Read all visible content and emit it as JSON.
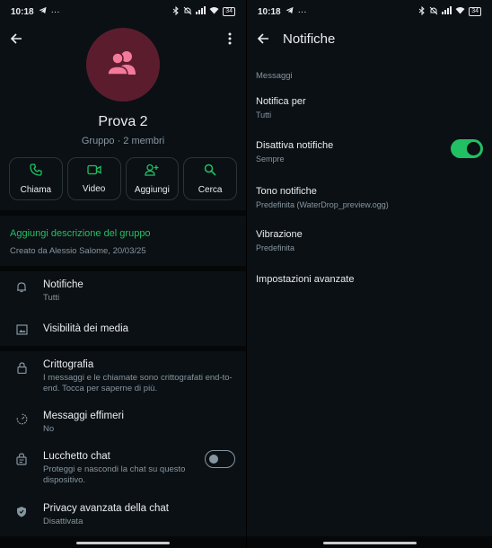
{
  "status_left": {
    "time": "10:18",
    "dots": "···",
    "battery": "34"
  },
  "status_right": {
    "time": "10:18",
    "dots": "···",
    "battery": "34"
  },
  "group_info": {
    "name": "Prova 2",
    "subtitle": "Gruppo · 2 membri",
    "actions": [
      {
        "label": "Chiama",
        "icon": "phone-icon"
      },
      {
        "label": "Video",
        "icon": "video-icon"
      },
      {
        "label": "Aggiungi",
        "icon": "add-person-icon"
      },
      {
        "label": "Cerca",
        "icon": "search-icon"
      }
    ],
    "add_description": "Aggiungi descrizione del gruppo",
    "created_by": "Creato da Alessio Salome, 20/03/25",
    "rows": [
      {
        "title": "Notifiche",
        "sub": "Tutti",
        "icon": "bell-icon"
      },
      {
        "title": "Visibilità dei media",
        "sub": "",
        "icon": "image-icon"
      },
      {
        "title": "Crittografia",
        "sub": "I messaggi e le chiamate sono crittografati end-to-end. Tocca per saperne di più.",
        "icon": "lock-icon"
      },
      {
        "title": "Messaggi effimeri",
        "sub": "No",
        "icon": "timer-icon"
      },
      {
        "title": "Lucchetto chat",
        "sub": "Proteggi e nascondi la chat su questo dispositivo.",
        "icon": "chat-lock-icon"
      },
      {
        "title": "Privacy avanzata della chat",
        "sub": "Disattivata",
        "icon": "shield-icon"
      }
    ]
  },
  "notifications": {
    "title": "Notifiche",
    "section": "Messaggi",
    "items": [
      {
        "title": "Notifica per",
        "sub": "Tutti"
      },
      {
        "title": "Disattiva notifiche",
        "sub": "Sempre"
      },
      {
        "title": "Tono notifiche",
        "sub": "Predefinita (WaterDrop_preview.ogg)"
      },
      {
        "title": "Vibrazione",
        "sub": "Predefinita"
      },
      {
        "title": "Impostazioni avanzate",
        "sub": ""
      }
    ],
    "mute_toggle_on": true
  },
  "chat_lock_toggle_on": false,
  "colors": {
    "accent": "#21c063",
    "background": "#0b1014",
    "avatar_bg": "#5b1d2e",
    "avatar_fg": "#f47a9b"
  }
}
